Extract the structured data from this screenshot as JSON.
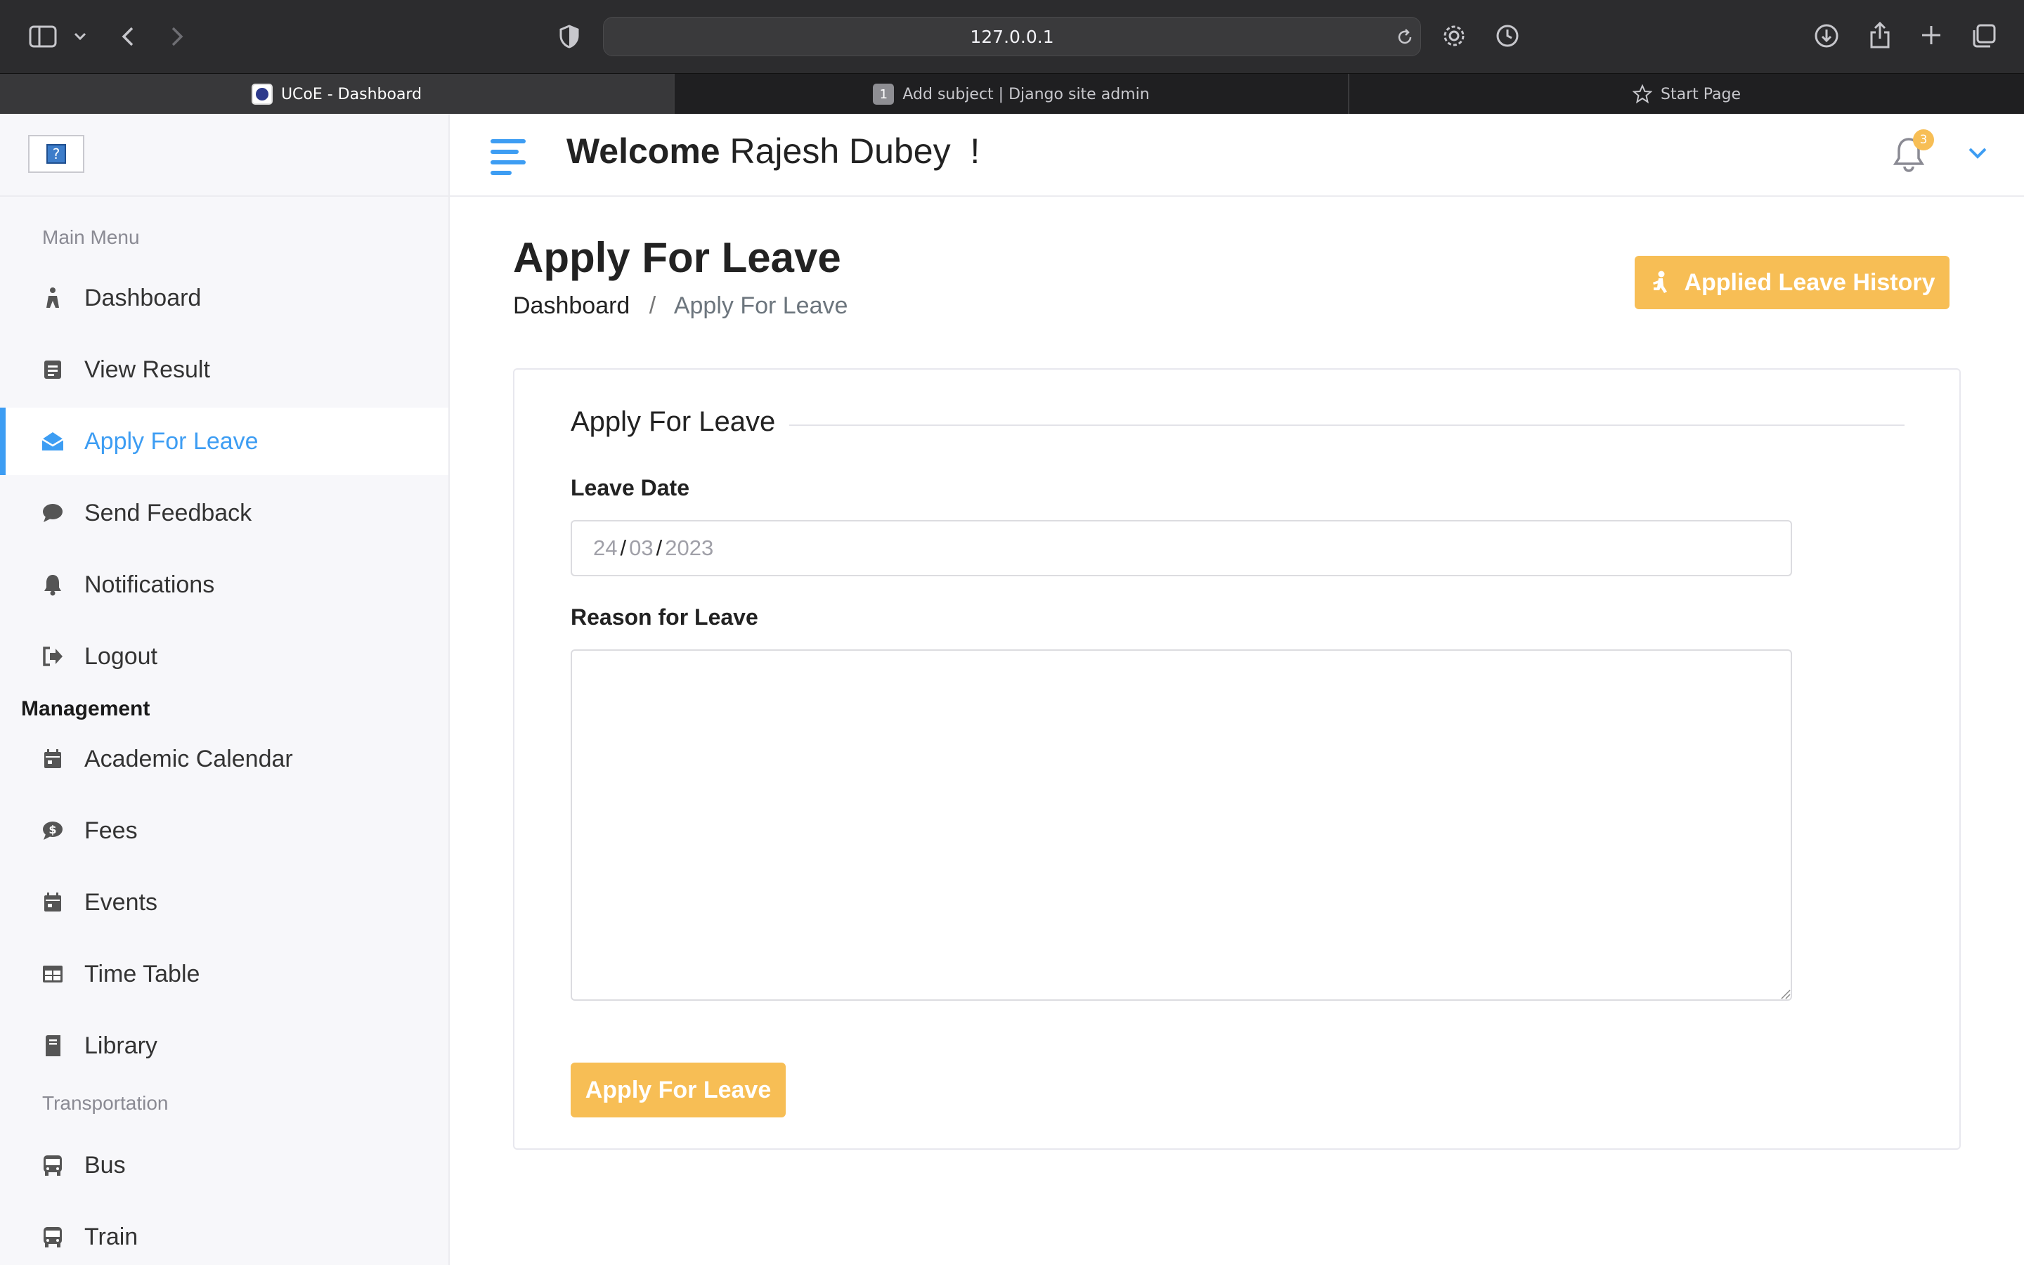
{
  "browser": {
    "url": "127.0.0.1",
    "tabs": [
      {
        "label": "UCoE - Dashboard",
        "active": true
      },
      {
        "label": "Add subject | Django site admin",
        "badge": "1",
        "active": false
      },
      {
        "label": "Start Page",
        "active": false
      }
    ]
  },
  "header": {
    "welcome_bold": "Welcome",
    "user_name": "Rajesh Dubey  !",
    "notification_count": "3"
  },
  "sidebar": {
    "main_menu_title": "Main Menu",
    "main_items": [
      {
        "label": "Dashboard",
        "icon": "dashboard-icon"
      },
      {
        "label": "View Result",
        "icon": "result-icon"
      },
      {
        "label": "Apply For Leave",
        "icon": "envelope-open-icon",
        "active": true
      },
      {
        "label": "Send Feedback",
        "icon": "comment-icon"
      },
      {
        "label": "Notifications",
        "icon": "bell-icon"
      },
      {
        "label": "Logout",
        "icon": "logout-icon"
      }
    ],
    "management_title": "Management",
    "management_items": [
      {
        "label": "Academic Calendar",
        "icon": "calendar-icon"
      },
      {
        "label": "Fees",
        "icon": "dollar-icon"
      },
      {
        "label": "Events",
        "icon": "calendar-icon"
      },
      {
        "label": "Time Table",
        "icon": "table-icon"
      },
      {
        "label": "Library",
        "icon": "book-icon"
      }
    ],
    "transportation_title": "Transportation",
    "transport_items": [
      {
        "label": "Bus",
        "icon": "bus-icon"
      },
      {
        "label": "Train",
        "icon": "train-icon"
      }
    ]
  },
  "page": {
    "title": "Apply For Leave",
    "breadcrumb": {
      "link": "Dashboard",
      "separator": "/",
      "current": "Apply For Leave"
    },
    "history_button": "Applied Leave History"
  },
  "form": {
    "legend": "Apply For Leave",
    "date_label": "Leave Date",
    "date_day": "24",
    "date_month": "03",
    "date_year": "2023",
    "date_separator": "/",
    "reason_label": "Reason for Leave",
    "reason_value": "",
    "submit_label": "Apply For Leave"
  },
  "colors": {
    "accent_blue": "#3d9df3",
    "accent_orange": "#f7be55",
    "sidebar_bg": "#f7f7fa",
    "chrome_bg": "#2c2c2e"
  }
}
